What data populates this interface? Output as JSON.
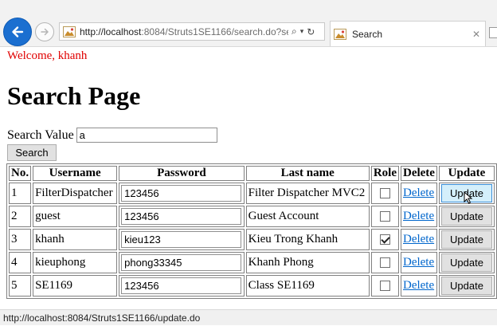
{
  "browser": {
    "url_host": "http://localhost",
    "url_rest": ":8084/Struts1SE1166/search.do?se",
    "tab_title": "Search",
    "status_url": "http://localhost:8084/Struts1SE1166/update.do"
  },
  "page": {
    "welcome": "Welcome, khanh",
    "heading": "Search Page",
    "search_label": "Search Value",
    "search_value": "a",
    "search_button": "Search"
  },
  "table": {
    "headers": [
      "No.",
      "Username",
      "Password",
      "Last name",
      "Role",
      "Delete",
      "Update"
    ],
    "rows": [
      {
        "no": "1",
        "username": "FilterDispatcher",
        "password": "123456",
        "lastname": "Filter Dispatcher MVC2",
        "role": false,
        "delete": "Delete",
        "update": "Update"
      },
      {
        "no": "2",
        "username": "guest",
        "password": "123456",
        "lastname": "Guest Account",
        "role": false,
        "delete": "Delete",
        "update": "Update"
      },
      {
        "no": "3",
        "username": "khanh",
        "password": "kieu123",
        "lastname": "Kieu Trong Khanh",
        "role": true,
        "delete": "Delete",
        "update": "Update"
      },
      {
        "no": "4",
        "username": "kieuphong",
        "password": "phong33345",
        "lastname": "Khanh Phong",
        "role": false,
        "delete": "Delete",
        "update": "Update"
      },
      {
        "no": "5",
        "username": "SE1169",
        "password": "123456",
        "lastname": "Class SE1169",
        "role": false,
        "delete": "Delete",
        "update": "Update"
      }
    ]
  },
  "icons": {
    "back": "back-arrow-icon",
    "forward": "forward-arrow-icon",
    "favicon": "page-favicon-icon",
    "search": "search-icon",
    "dropdown": "chevron-down-icon",
    "refresh": "refresh-icon",
    "close": "close-tab-icon"
  },
  "colors": {
    "welcome": "#e00000",
    "link": "#0066cc",
    "back_button": "#1b6fd0"
  }
}
